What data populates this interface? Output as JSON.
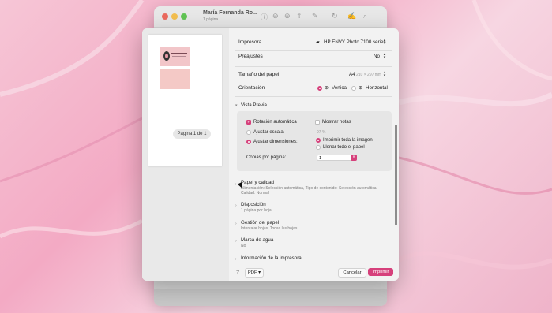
{
  "background_window": {
    "title": "María Fernanda Ro...",
    "subtitle": "1 página"
  },
  "preview": {
    "page_indicator": "Página 1 de 1"
  },
  "printer": {
    "label": "Impresora",
    "value": "HP ENVY Photo 7100 series"
  },
  "presets": {
    "label": "Preajustes",
    "value": "No"
  },
  "paper_size": {
    "label": "Tamaño del papel",
    "value": "A4",
    "dimensions": "210 × 297 mm"
  },
  "orientation": {
    "label": "Orientación",
    "vertical": "Vertical",
    "horizontal": "Horizontal",
    "selected": "vertical"
  },
  "preview_section": {
    "title": "Vista Previa",
    "auto_rotate": "Rotación automática",
    "show_notes": "Mostrar notas",
    "scale_label": "Ajustar escala:",
    "scale_value": "97 %",
    "fit_label": "Ajustar dimensiones:",
    "print_entire": "Imprimir toda la imagen",
    "fill_paper": "Llenar todo el papel",
    "copies_label": "Copias por página:",
    "copies_value": "1"
  },
  "sections": [
    {
      "title": "Papel y calidad",
      "desc": "Alimentación: Selección automática, Tipo de contenido: Selección automática, Calidad: Normal"
    },
    {
      "title": "Disposición",
      "desc": "1 página por hoja"
    },
    {
      "title": "Gestión del papel",
      "desc": "Intercalar hojas, Todas las hojas"
    },
    {
      "title": "Marca de agua",
      "desc": "No"
    },
    {
      "title": "Información de la impresora",
      "desc": ""
    }
  ],
  "footer": {
    "help": "?",
    "pdf": "PDF",
    "cancel": "Cancelar",
    "print": "Imprimir"
  },
  "colors": {
    "accent": "#d6407b"
  }
}
